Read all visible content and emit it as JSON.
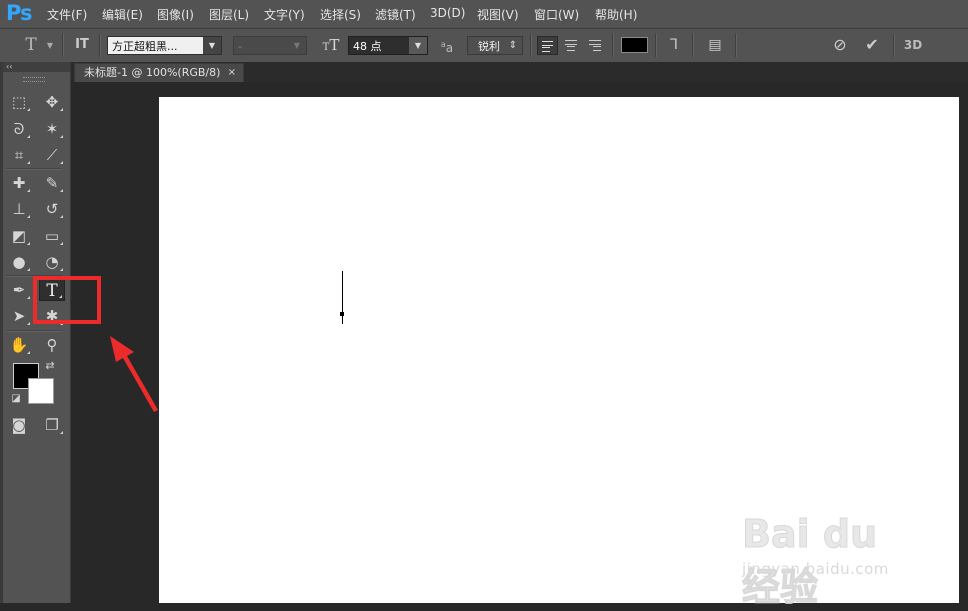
{
  "app": {
    "logo": "Ps",
    "menu": [
      "文件(F)",
      "编辑(E)",
      "图像(I)",
      "图层(L)",
      "文字(Y)",
      "选择(S)",
      "滤镜(T)",
      "3D(D)",
      "视图(V)",
      "窗口(W)",
      "帮助(H)"
    ]
  },
  "options": {
    "tool_glyph": "T",
    "orientation_glyph": "IT",
    "font_family": "方正超粗黑...",
    "font_style": "-",
    "size_glyph": "T",
    "font_size": "48 点",
    "aa_glyph": "a",
    "antialias": "锐利",
    "text_color": "#000000",
    "threed_label": "3D"
  },
  "panel": {
    "collapse": "‹‹"
  },
  "tools": [
    {
      "name": "marquee-tool",
      "glyph": "⬚"
    },
    {
      "name": "move-tool",
      "glyph": "✥"
    },
    {
      "name": "lasso-tool",
      "glyph": "ᘐ"
    },
    {
      "name": "magic-wand-tool",
      "glyph": "✶"
    },
    {
      "name": "crop-tool",
      "glyph": "⌗"
    },
    {
      "name": "eyedropper-tool",
      "glyph": "⟋"
    },
    {
      "name": "healing-brush-tool",
      "glyph": "✚"
    },
    {
      "name": "brush-tool",
      "glyph": "✎"
    },
    {
      "name": "clone-stamp-tool",
      "glyph": "⊥"
    },
    {
      "name": "history-brush-tool",
      "glyph": "↺"
    },
    {
      "name": "eraser-tool",
      "glyph": "◩"
    },
    {
      "name": "gradient-tool",
      "glyph": "▭"
    },
    {
      "name": "blur-tool",
      "glyph": "●"
    },
    {
      "name": "dodge-tool",
      "glyph": "◔"
    },
    {
      "name": "pen-tool",
      "glyph": "✒"
    },
    {
      "name": "type-tool",
      "glyph": "T"
    },
    {
      "name": "path-selection-tool",
      "glyph": "➤"
    },
    {
      "name": "shape-tool",
      "glyph": "✱"
    },
    {
      "name": "hand-tool",
      "glyph": "✋"
    },
    {
      "name": "zoom-tool",
      "glyph": "⚲"
    },
    {
      "name": "swap-colors",
      "glyph": "⇄"
    },
    {
      "name": "default-colors",
      "glyph": "◪"
    },
    {
      "name": "quick-mask",
      "glyph": "◙"
    },
    {
      "name": "screen-mode",
      "glyph": "❐"
    }
  ],
  "colors": {
    "foreground": "#000000",
    "background": "#ffffff",
    "highlight": "#ed2b2b"
  },
  "document": {
    "tab_title": "未标题-1 @ 100%(RGB/8)",
    "close": "×"
  },
  "watermark": {
    "brand": "Bai du 经验",
    "sub": "jingyan.baidu.com"
  }
}
